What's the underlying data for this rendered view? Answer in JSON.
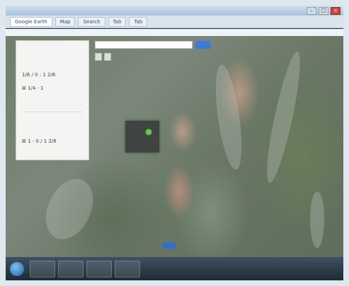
{
  "browser": {
    "tabs": [
      "Google Earth",
      "Map",
      "Search",
      "Tab",
      "Tab"
    ],
    "window_controls": [
      "–",
      "□",
      "×"
    ]
  },
  "map": {
    "search_placeholder": "",
    "search_button": "",
    "toggles": [
      "",
      ""
    ]
  },
  "panel": {
    "rows": [
      {
        "text": "",
        "style": "muted"
      },
      {
        "text": "1/6 / 0 : 1 2/6",
        "style": "normal"
      },
      {
        "text": "⊞ 1/4 · 1",
        "style": "normal"
      },
      {
        "text": "",
        "style": "muted"
      },
      {
        "text": "",
        "style": "link"
      },
      {
        "text": "⊞ 1 - 0 / 1 2/6",
        "style": "normal"
      },
      {
        "text": "",
        "style": "muted"
      }
    ]
  },
  "pin": {
    "label": ""
  },
  "taskbar": {
    "clock_time": "",
    "clock_date": ""
  },
  "colors": {
    "accent": "#3a7bd5",
    "pin": "#69c64a",
    "panel_bg": "#f4f5f3"
  }
}
